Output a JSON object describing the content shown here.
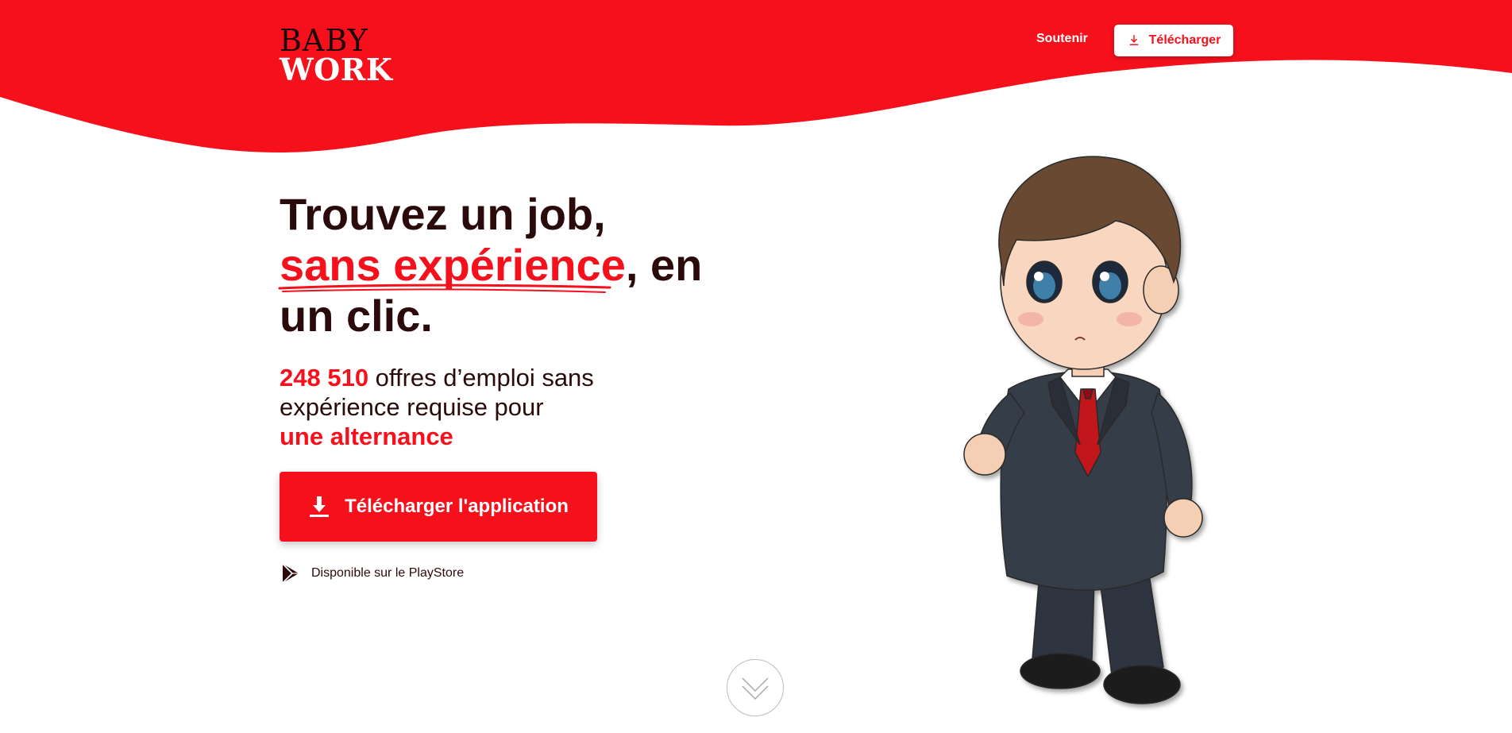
{
  "brand": {
    "logo_top": "BABY",
    "logo_bottom": "WORK",
    "accent_color": "#f5101c",
    "text_color": "#2a0a0a"
  },
  "nav": {
    "support_label": "Soutenir",
    "download_label": "Télécharger",
    "download_icon": "download-icon"
  },
  "hero": {
    "title_line1": "Trouvez un job,",
    "title_highlight": "sans expérience",
    "title_after_highlight": ", en",
    "title_line3": "un clic.",
    "offers_count": "248 510",
    "offers_text": " offres d’emploi sans expérience requise pour",
    "offers_type": "une alternance",
    "cta_label": "Télécharger l'application",
    "cta_icon": "download-icon",
    "store_label": "Disponible sur le PlayStore",
    "store_icon": "play-store-icon"
  },
  "scroll": {
    "icon": "chevron-down-icon"
  },
  "illustration": {
    "name": "mascot-baby-businessman"
  }
}
